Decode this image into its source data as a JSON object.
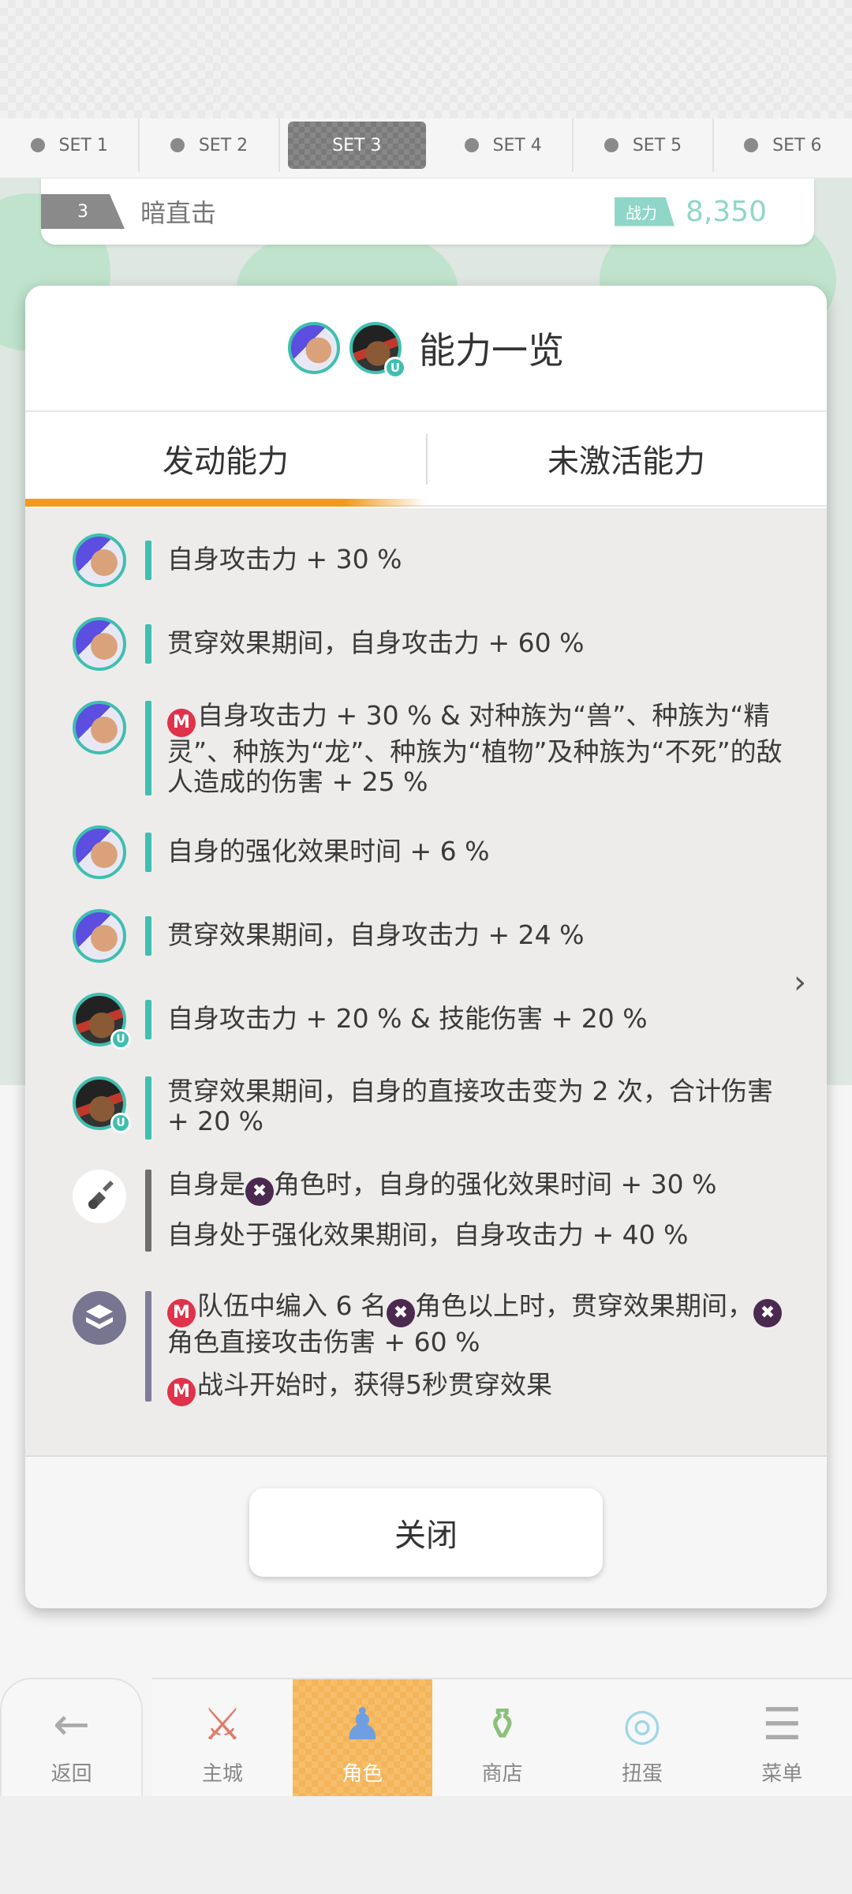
{
  "set_tabs": [
    "SET 1",
    "SET 2",
    "SET 3",
    "SET 4",
    "SET 5",
    "SET 6"
  ],
  "active_set": "SET 3",
  "team": {
    "number": "3",
    "name": "暗直击",
    "power_label": "战力",
    "power_value": "8,350"
  },
  "modal": {
    "title": "能力一览",
    "tabs": [
      "发动能力",
      "未激活能力"
    ],
    "active_tab": "发动能力",
    "abilities": [
      {
        "lines": [
          "自身攻击力 + 30 %"
        ]
      },
      {
        "lines": [
          "贯穿效果期间，自身攻击力 + 60 %"
        ]
      },
      {
        "lines": [
          "自身攻击力 + 30 % & 对种族为“兽”、种族为“精灵”、种族为“龙”、种族为“植物”及种族为“不死”的敌人造成的伤害 + 25 %"
        ],
        "mark": "M"
      },
      {
        "lines": [
          "自身的强化效果时间 + 6 %"
        ]
      },
      {
        "lines": [
          "贯穿效果期间，自身攻击力 + 24 %"
        ]
      },
      {
        "lines": [
          "自身攻击力 + 20 % & 技能伤害 + 20 %"
        ]
      },
      {
        "lines": [
          "贯穿效果期间，自身的直接攻击变为 2 次，合计伤害 + 20 %"
        ]
      },
      {
        "line1a": "自身是",
        "line1b": "角色时，自身的强化效果时间 + 30 %",
        "line2": "自身处于强化效果期间，自身攻击力 + 40 %"
      },
      {
        "l1a": "队伍中编入 6 名",
        "l1b": "角色以上时，贯穿效果期间，",
        "l1c": "角色直接攻击伤害 + 60 %",
        "l2": "战斗开始时，获得5秒贯穿效果"
      }
    ],
    "mark_letter": "M",
    "close_label": "关闭"
  },
  "bottom_nav": [
    {
      "label": "返回",
      "icon": "back-arrow-icon"
    },
    {
      "label": "主城",
      "icon": "castle-icon"
    },
    {
      "label": "角色",
      "icon": "character-icon"
    },
    {
      "label": "商店",
      "icon": "shop-icon"
    },
    {
      "label": "扭蛋",
      "icon": "gacha-icon"
    },
    {
      "label": "菜单",
      "icon": "menu-icon"
    }
  ],
  "colors": {
    "accent": "#f39a1e",
    "teal": "#3fbfb0",
    "mark_red": "#e0324b"
  }
}
